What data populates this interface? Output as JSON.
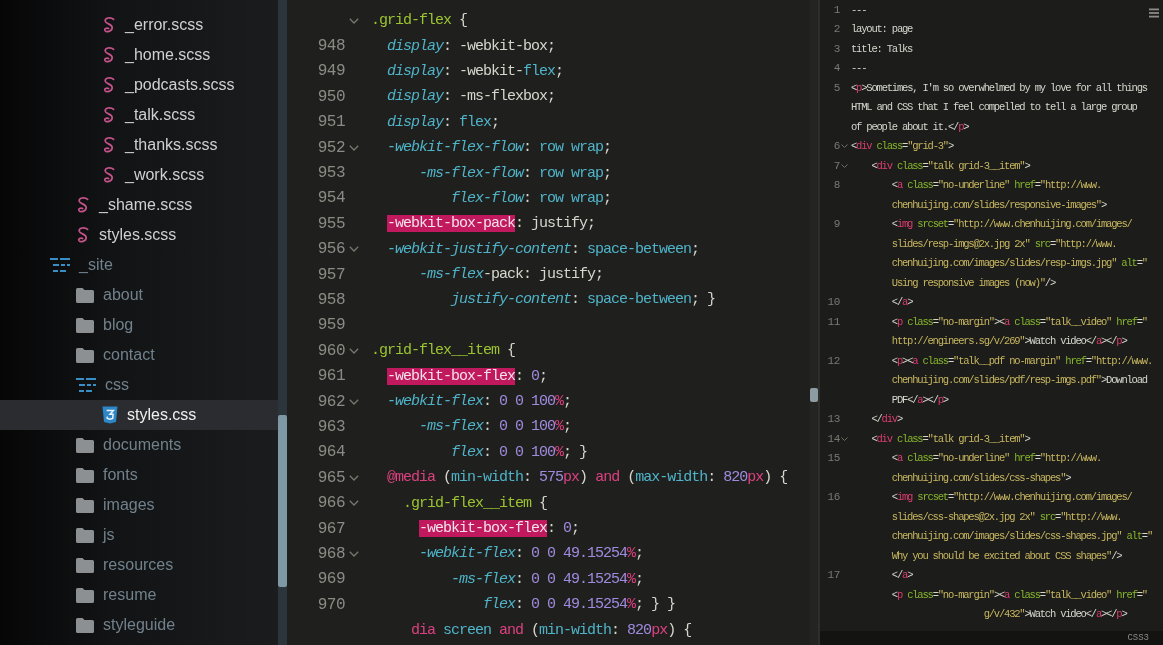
{
  "file_tree": {
    "items": [
      {
        "children": [
          {
            "children": [
              {
                "label": "_error.scss",
                "kind": "scss",
                "selected": false
              },
              {
                "label": "_home.scss",
                "kind": "scss",
                "selected": false
              },
              {
                "label": "_podcasts.scss",
                "kind": "scss",
                "selected": false
              },
              {
                "label": "_talk.scss",
                "kind": "scss",
                "selected": false
              },
              {
                "label": "_thanks.scss",
                "kind": "scss",
                "selected": false
              },
              {
                "label": "_work.scss",
                "kind": "scss",
                "selected": false
              }
            ]
          },
          {
            "label": "_shame.scss",
            "kind": "scss",
            "selected": false
          },
          {
            "label": "styles.scss",
            "kind": "scss",
            "selected": false
          }
        ]
      },
      {
        "label": "_site",
        "kind": "folder",
        "expanded": true,
        "selected": false,
        "children": [
          {
            "label": "about",
            "kind": "folder",
            "expanded": false,
            "selected": false
          },
          {
            "label": "blog",
            "kind": "folder",
            "expanded": false,
            "selected": false
          },
          {
            "label": "contact",
            "kind": "folder",
            "expanded": false,
            "selected": false
          },
          {
            "label": "css",
            "kind": "folder",
            "expanded": true,
            "selected": false,
            "children": [
              {
                "label": "styles.css",
                "kind": "css",
                "selected": true
              }
            ]
          },
          {
            "label": "documents",
            "kind": "folder",
            "expanded": false,
            "selected": false
          },
          {
            "label": "fonts",
            "kind": "folder",
            "expanded": false,
            "selected": false
          },
          {
            "label": "images",
            "kind": "folder",
            "expanded": false,
            "selected": false
          },
          {
            "label": "js",
            "kind": "folder",
            "expanded": false,
            "selected": false
          },
          {
            "label": "resources",
            "kind": "folder",
            "expanded": false,
            "selected": false
          },
          {
            "label": "resume",
            "kind": "folder",
            "expanded": false,
            "selected": false
          },
          {
            "label": "styleguide",
            "kind": "folder",
            "expanded": false,
            "selected": false
          }
        ]
      }
    ]
  },
  "main_editor": {
    "lines": [
      {
        "foldable": true,
        "rows": [
          {
            "tokens": [
              {
                "kind": "selector",
                "text": ".grid-flex"
              },
              {
                "kind": "punct",
                "text": " {"
              }
            ]
          }
        ]
      },
      {
        "number": "948",
        "foldable": false,
        "rows": [
          {
            "tokens": [
              {
                "kind": "property",
                "text": "  display"
              },
              {
                "kind": "punct",
                "text": ": "
              },
              {
                "kind": "plain",
                "text": "-webkit-box"
              },
              {
                "kind": "punct",
                "text": ";"
              }
            ]
          }
        ]
      },
      {
        "number": "949",
        "foldable": false,
        "rows": [
          {
            "tokens": [
              {
                "kind": "property",
                "text": "  display"
              },
              {
                "kind": "punct",
                "text": ": "
              },
              {
                "kind": "plain",
                "text": "-webkit-"
              },
              {
                "kind": "value",
                "text": "flex"
              },
              {
                "kind": "punct",
                "text": ";"
              }
            ]
          }
        ]
      },
      {
        "number": "950",
        "foldable": false,
        "rows": [
          {
            "tokens": [
              {
                "kind": "property",
                "text": "  display"
              },
              {
                "kind": "punct",
                "text": ": "
              },
              {
                "kind": "plain",
                "text": "-ms-flexbox"
              },
              {
                "kind": "punct",
                "text": ";"
              }
            ]
          }
        ]
      },
      {
        "number": "951",
        "foldable": false,
        "rows": [
          {
            "tokens": [
              {
                "kind": "property",
                "text": "  display"
              },
              {
                "kind": "punct",
                "text": ": "
              },
              {
                "kind": "value",
                "text": "flex"
              },
              {
                "kind": "punct",
                "text": ";"
              }
            ]
          }
        ]
      },
      {
        "number": "952",
        "foldable": true,
        "rows": [
          {
            "tokens": [
              {
                "kind": "property",
                "text": "  -webkit-flex-flow"
              },
              {
                "kind": "punct",
                "text": ": "
              },
              {
                "kind": "value",
                "text": "row wrap"
              },
              {
                "kind": "punct",
                "text": ";"
              }
            ]
          }
        ]
      },
      {
        "number": "953",
        "foldable": false,
        "rows": [
          {
            "tokens": [
              {
                "kind": "property",
                "text": "      -ms-flex-flow"
              },
              {
                "kind": "punct",
                "text": ": "
              },
              {
                "kind": "value",
                "text": "row wrap"
              },
              {
                "kind": "punct",
                "text": ";"
              }
            ]
          }
        ]
      },
      {
        "number": "954",
        "foldable": false,
        "rows": [
          {
            "tokens": [
              {
                "kind": "property",
                "text": "          flex-flow"
              },
              {
                "kind": "punct",
                "text": ": "
              },
              {
                "kind": "value",
                "text": "row wrap"
              },
              {
                "kind": "punct",
                "text": ";"
              }
            ]
          }
        ]
      },
      {
        "number": "955",
        "foldable": false,
        "rows": [
          {
            "tokens": [
              {
                "kind": "match",
                "text": "  -webkit-box-pack"
              },
              {
                "kind": "punct",
                "text": ": "
              },
              {
                "kind": "plain",
                "text": "justify"
              },
              {
                "kind": "punct",
                "text": ";"
              }
            ]
          }
        ]
      },
      {
        "number": "956",
        "foldable": true,
        "rows": [
          {
            "tokens": [
              {
                "kind": "property",
                "text": "  -webkit-justify-content"
              },
              {
                "kind": "punct",
                "text": ": "
              },
              {
                "kind": "value",
                "text": "space-between"
              },
              {
                "kind": "punct",
                "text": ";"
              }
            ]
          }
        ]
      },
      {
        "number": "957",
        "foldable": false,
        "rows": [
          {
            "tokens": [
              {
                "kind": "property",
                "text": "      -ms-flex"
              },
              {
                "kind": "plain",
                "text": "-pack"
              },
              {
                "kind": "punct",
                "text": ": "
              },
              {
                "kind": "plain",
                "text": "justify"
              },
              {
                "kind": "punct",
                "text": ";"
              }
            ]
          }
        ]
      },
      {
        "number": "958",
        "foldable": false,
        "rows": [
          {
            "tokens": [
              {
                "kind": "property",
                "text": "          justify-content"
              },
              {
                "kind": "punct",
                "text": ": "
              },
              {
                "kind": "value",
                "text": "space-between"
              },
              {
                "kind": "punct",
                "text": "; }"
              }
            ]
          }
        ]
      },
      {
        "number": "959",
        "foldable": false
      },
      {
        "number": "960",
        "foldable": true,
        "rows": [
          {
            "tokens": [
              {
                "kind": "selector",
                "text": ".grid-flex__item"
              },
              {
                "kind": "punct",
                "text": " {"
              }
            ]
          }
        ]
      },
      {
        "number": "961",
        "foldable": false,
        "rows": [
          {
            "tokens": [
              {
                "kind": "match",
                "text": "  -webkit-box-flex"
              },
              {
                "kind": "punct",
                "text": ": "
              },
              {
                "kind": "number",
                "text": "0"
              },
              {
                "kind": "punct",
                "text": ";"
              }
            ]
          }
        ]
      },
      {
        "number": "962",
        "foldable": true,
        "rows": [
          {
            "tokens": [
              {
                "kind": "property",
                "text": "  -webkit-flex"
              },
              {
                "kind": "punct",
                "text": ": "
              },
              {
                "kind": "number",
                "text": "0 0 100"
              },
              {
                "kind": "unit",
                "text": "%"
              },
              {
                "kind": "punct",
                "text": ";"
              }
            ]
          }
        ]
      },
      {
        "number": "963",
        "foldable": false,
        "rows": [
          {
            "tokens": [
              {
                "kind": "property",
                "text": "      -ms-flex"
              },
              {
                "kind": "punct",
                "text": ": "
              },
              {
                "kind": "number",
                "text": "0 0 100"
              },
              {
                "kind": "unit",
                "text": "%"
              },
              {
                "kind": "punct",
                "text": ";"
              }
            ]
          }
        ]
      },
      {
        "number": "964",
        "foldable": false,
        "rows": [
          {
            "tokens": [
              {
                "kind": "property",
                "text": "          flex"
              },
              {
                "kind": "punct",
                "text": ": "
              },
              {
                "kind": "number",
                "text": "0 0 100"
              },
              {
                "kind": "unit",
                "text": "%"
              },
              {
                "kind": "punct",
                "text": "; }"
              }
            ]
          }
        ]
      },
      {
        "number": "965",
        "foldable": true,
        "rows": [
          {
            "tokens": [
              {
                "kind": "atrule",
                "text": "  @media"
              },
              {
                "kind": "punct",
                "text": " ("
              },
              {
                "kind": "value",
                "text": "min-width"
              },
              {
                "kind": "punct",
                "text": ": "
              },
              {
                "kind": "number",
                "text": "575"
              },
              {
                "kind": "unit",
                "text": "px"
              },
              {
                "kind": "punct",
                "text": ") "
              },
              {
                "kind": "atrule",
                "text": "and"
              },
              {
                "kind": "punct",
                "text": " ("
              },
              {
                "kind": "value",
                "text": "max-width"
              },
              {
                "kind": "punct",
                "text": ": "
              },
              {
                "kind": "number",
                "text": "820"
              },
              {
                "kind": "unit",
                "text": "px"
              },
              {
                "kind": "punct",
                "text": ") {"
              }
            ]
          }
        ]
      },
      {
        "number": "966",
        "foldable": true,
        "rows": [
          {
            "tokens": [
              {
                "kind": "selector",
                "text": "    .grid-flex__item"
              },
              {
                "kind": "punct",
                "text": " {"
              }
            ]
          }
        ]
      },
      {
        "number": "967",
        "foldable": false,
        "rows": [
          {
            "tokens": [
              {
                "kind": "match",
                "text": "      -webkit-box-flex"
              },
              {
                "kind": "punct",
                "text": ": "
              },
              {
                "kind": "number",
                "text": "0"
              },
              {
                "kind": "punct",
                "text": ";"
              }
            ]
          }
        ]
      },
      {
        "number": "968",
        "foldable": true,
        "rows": [
          {
            "tokens": [
              {
                "kind": "property",
                "text": "      -webkit-flex"
              },
              {
                "kind": "punct",
                "text": ": "
              },
              {
                "kind": "number",
                "text": "0 0 49.15254"
              },
              {
                "kind": "unit",
                "text": "%"
              },
              {
                "kind": "punct",
                "text": ";"
              }
            ]
          }
        ]
      },
      {
        "number": "969",
        "foldable": false,
        "rows": [
          {
            "tokens": [
              {
                "kind": "property",
                "text": "          -ms-flex"
              },
              {
                "kind": "punct",
                "text": ": "
              },
              {
                "kind": "number",
                "text": "0 0 49.15254"
              },
              {
                "kind": "unit",
                "text": "%"
              },
              {
                "kind": "punct",
                "text": ";"
              }
            ]
          }
        ]
      },
      {
        "number": "970",
        "foldable": false,
        "rows": [
          {
            "tokens": [
              {
                "kind": "property",
                "text": "              flex"
              },
              {
                "kind": "punct",
                "text": ": "
              },
              {
                "kind": "number",
                "text": "0 0 49.15254"
              },
              {
                "kind": "unit",
                "text": "%"
              },
              {
                "kind": "punct",
                "text": "; } }"
              }
            ]
          }
        ]
      },
      {
        "foldable": false,
        "rows": [
          {
            "tokens": [
              {
                "kind": "atrule",
                "text": "     dia"
              },
              {
                "kind": "value",
                "text": " screen "
              },
              {
                "kind": "atrule",
                "text": "and"
              },
              {
                "kind": "punct",
                "text": " ("
              },
              {
                "kind": "value",
                "text": "min-width"
              },
              {
                "kind": "punct",
                "text": ": "
              },
              {
                "kind": "number",
                "text": "820"
              },
              {
                "kind": "unit",
                "text": "px"
              },
              {
                "kind": "punct",
                "text": ") {"
              }
            ]
          }
        ]
      }
    ]
  },
  "side_editor": {
    "lines": [
      {
        "number": "1",
        "foldable": false,
        "rows": [
          {
            "tokens": [
              {
                "kind": "text",
                "text": "---"
              }
            ]
          }
        ]
      },
      {
        "number": "2",
        "foldable": false,
        "rows": [
          {
            "tokens": [
              {
                "kind": "text",
                "text": "layout: page"
              }
            ]
          }
        ]
      },
      {
        "number": "3",
        "foldable": false,
        "rows": [
          {
            "tokens": [
              {
                "kind": "text",
                "text": "title: Talks"
              }
            ]
          }
        ]
      },
      {
        "number": "4",
        "foldable": false,
        "rows": [
          {
            "tokens": [
              {
                "kind": "text",
                "text": "---"
              }
            ]
          }
        ]
      },
      {
        "number": "5",
        "foldable": false,
        "rows": [
          {
            "tokens": [
              {
                "kind": "punct",
                "text": "<"
              },
              {
                "kind": "tag",
                "text": "p"
              },
              {
                "kind": "punct",
                "text": ">"
              },
              {
                "kind": "text",
                "text": "Sometimes, I'm so overwhelmed by my love for all things"
              }
            ]
          },
          {
            "tokens": [
              {
                "kind": "text",
                "text": "HTML and CSS that I feel compelled to tell a large group"
              }
            ]
          },
          {
            "tokens": [
              {
                "kind": "text",
                "text": "of people about it."
              },
              {
                "kind": "punct",
                "text": "</"
              },
              {
                "kind": "tag",
                "text": "p"
              },
              {
                "kind": "punct",
                "text": ">"
              }
            ]
          }
        ]
      },
      {
        "number": "6",
        "foldable": true,
        "rows": [
          {
            "tokens": [
              {
                "kind": "punct",
                "text": "<"
              },
              {
                "kind": "tag",
                "text": "div"
              },
              {
                "kind": "attr",
                "text": " class"
              },
              {
                "kind": "punct",
                "text": "="
              },
              {
                "kind": "string",
                "text": "\"grid-3\""
              },
              {
                "kind": "punct",
                "text": ">"
              }
            ]
          }
        ]
      },
      {
        "number": "7",
        "foldable": true,
        "rows": [
          {
            "tokens": [
              {
                "kind": "punct",
                "text": "    <"
              },
              {
                "kind": "tag",
                "text": "div"
              },
              {
                "kind": "attr",
                "text": " class"
              },
              {
                "kind": "punct",
                "text": "="
              },
              {
                "kind": "string",
                "text": "\"talk grid-3__item\""
              },
              {
                "kind": "punct",
                "text": ">"
              }
            ]
          }
        ]
      },
      {
        "number": "8",
        "foldable": false,
        "rows": [
          {
            "tokens": [
              {
                "kind": "punct",
                "text": "        <"
              },
              {
                "kind": "tag",
                "text": "a"
              },
              {
                "kind": "attr",
                "text": " class"
              },
              {
                "kind": "punct",
                "text": "="
              },
              {
                "kind": "string",
                "text": "\"no-underline\""
              },
              {
                "kind": "attr",
                "text": " href"
              },
              {
                "kind": "punct",
                "text": "="
              },
              {
                "kind": "string",
                "text": "\"http://www."
              }
            ]
          },
          {
            "tokens": [
              {
                "kind": "string",
                "text": "        chenhuijing.com/slides/responsive-images\""
              },
              {
                "kind": "punct",
                "text": ">"
              }
            ]
          }
        ]
      },
      {
        "number": "9",
        "foldable": false,
        "rows": [
          {
            "tokens": [
              {
                "kind": "punct",
                "text": "        <"
              },
              {
                "kind": "tag",
                "text": "img"
              },
              {
                "kind": "attr",
                "text": " srcset"
              },
              {
                "kind": "punct",
                "text": "="
              },
              {
                "kind": "string",
                "text": "\"http://www.chenhuijing.com/images/"
              }
            ]
          },
          {
            "tokens": [
              {
                "kind": "string",
                "text": "        slides/resp-imgs@2x.jpg 2x\""
              },
              {
                "kind": "attr",
                "text": " src"
              },
              {
                "kind": "punct",
                "text": "="
              },
              {
                "kind": "string",
                "text": "\"http://www."
              }
            ]
          },
          {
            "tokens": [
              {
                "kind": "string",
                "text": "        chenhuijing.com/images/slides/resp-imgs.jpg\""
              },
              {
                "kind": "attr",
                "text": " alt"
              },
              {
                "kind": "punct",
                "text": "="
              },
              {
                "kind": "string",
                "text": "\""
              }
            ]
          },
          {
            "tokens": [
              {
                "kind": "string",
                "text": "        Using responsive images (now)\""
              },
              {
                "kind": "punct",
                "text": "/>"
              }
            ]
          }
        ]
      },
      {
        "number": "10",
        "foldable": false,
        "rows": [
          {
            "tokens": [
              {
                "kind": "punct",
                "text": "        </"
              },
              {
                "kind": "tag",
                "text": "a"
              },
              {
                "kind": "punct",
                "text": ">"
              }
            ]
          }
        ]
      },
      {
        "number": "11",
        "foldable": false,
        "rows": [
          {
            "tokens": [
              {
                "kind": "punct",
                "text": "        <"
              },
              {
                "kind": "tag",
                "text": "p"
              },
              {
                "kind": "attr",
                "text": " class"
              },
              {
                "kind": "punct",
                "text": "="
              },
              {
                "kind": "string",
                "text": "\"no-margin\""
              },
              {
                "kind": "punct",
                "text": "><"
              },
              {
                "kind": "tag",
                "text": "a"
              },
              {
                "kind": "attr",
                "text": " class"
              },
              {
                "kind": "punct",
                "text": "="
              },
              {
                "kind": "string",
                "text": "\"talk__video\""
              },
              {
                "kind": "attr",
                "text": " href"
              },
              {
                "kind": "punct",
                "text": "="
              },
              {
                "kind": "string",
                "text": "\""
              }
            ]
          },
          {
            "tokens": [
              {
                "kind": "string",
                "text": "        http://engineers.sg/v/269\""
              },
              {
                "kind": "punct",
                "text": ">"
              },
              {
                "kind": "text",
                "text": "Watch video"
              },
              {
                "kind": "punct",
                "text": "</"
              },
              {
                "kind": "tag",
                "text": "a"
              },
              {
                "kind": "punct",
                "text": "></"
              },
              {
                "kind": "tag",
                "text": "p"
              },
              {
                "kind": "punct",
                "text": ">"
              }
            ]
          }
        ]
      },
      {
        "number": "12",
        "foldable": false,
        "rows": [
          {
            "tokens": [
              {
                "kind": "punct",
                "text": "        <"
              },
              {
                "kind": "tag",
                "text": "p"
              },
              {
                "kind": "punct",
                "text": "><"
              },
              {
                "kind": "tag",
                "text": "a"
              },
              {
                "kind": "attr",
                "text": " class"
              },
              {
                "kind": "punct",
                "text": "="
              },
              {
                "kind": "string",
                "text": "\"talk__pdf no-margin\""
              },
              {
                "kind": "attr",
                "text": " href"
              },
              {
                "kind": "punct",
                "text": "="
              },
              {
                "kind": "string",
                "text": "\"http://www."
              }
            ]
          },
          {
            "tokens": [
              {
                "kind": "string",
                "text": "        chenhuijing.com/slides/pdf/resp-imgs.pdf\""
              },
              {
                "kind": "punct",
                "text": ">"
              },
              {
                "kind": "text",
                "text": "Download"
              }
            ]
          },
          {
            "tokens": [
              {
                "kind": "text",
                "text": "        PDF"
              },
              {
                "kind": "punct",
                "text": "</"
              },
              {
                "kind": "tag",
                "text": "a"
              },
              {
                "kind": "punct",
                "text": "></"
              },
              {
                "kind": "tag",
                "text": "p"
              },
              {
                "kind": "punct",
                "text": ">"
              }
            ]
          }
        ]
      },
      {
        "number": "13",
        "foldable": false,
        "rows": [
          {
            "tokens": [
              {
                "kind": "punct",
                "text": "    </"
              },
              {
                "kind": "tag",
                "text": "div"
              },
              {
                "kind": "punct",
                "text": ">"
              }
            ]
          }
        ]
      },
      {
        "number": "14",
        "foldable": true,
        "rows": [
          {
            "tokens": [
              {
                "kind": "punct",
                "text": "    <"
              },
              {
                "kind": "tag",
                "text": "div"
              },
              {
                "kind": "attr",
                "text": " class"
              },
              {
                "kind": "punct",
                "text": "="
              },
              {
                "kind": "string",
                "text": "\"talk grid-3__item\""
              },
              {
                "kind": "punct",
                "text": ">"
              }
            ]
          }
        ]
      },
      {
        "number": "15",
        "foldable": false,
        "rows": [
          {
            "tokens": [
              {
                "kind": "punct",
                "text": "        <"
              },
              {
                "kind": "tag",
                "text": "a"
              },
              {
                "kind": "attr",
                "text": " class"
              },
              {
                "kind": "punct",
                "text": "="
              },
              {
                "kind": "string",
                "text": "\"no-underline\""
              },
              {
                "kind": "attr",
                "text": " href"
              },
              {
                "kind": "punct",
                "text": "="
              },
              {
                "kind": "string",
                "text": "\"http://www."
              }
            ]
          },
          {
            "tokens": [
              {
                "kind": "string",
                "text": "        chenhuijing.com/slides/css-shapes\""
              },
              {
                "kind": "punct",
                "text": ">"
              }
            ]
          }
        ]
      },
      {
        "number": "16",
        "foldable": false,
        "rows": [
          {
            "tokens": [
              {
                "kind": "punct",
                "text": "        <"
              },
              {
                "kind": "tag",
                "text": "img"
              },
              {
                "kind": "attr",
                "text": " srcset"
              },
              {
                "kind": "punct",
                "text": "="
              },
              {
                "kind": "string",
                "text": "\"http://www.chenhuijing.com/images/"
              }
            ]
          },
          {
            "tokens": [
              {
                "kind": "string",
                "text": "        slides/css-shapes@2x.jpg 2x\""
              },
              {
                "kind": "attr",
                "text": " src"
              },
              {
                "kind": "punct",
                "text": "="
              },
              {
                "kind": "string",
                "text": "\"http://www."
              }
            ]
          },
          {
            "tokens": [
              {
                "kind": "string",
                "text": "        chenhuijing.com/images/slides/css-shapes.jpg\""
              },
              {
                "kind": "attr",
                "text": " alt"
              },
              {
                "kind": "punct",
                "text": "="
              },
              {
                "kind": "string",
                "text": "\""
              }
            ]
          },
          {
            "tokens": [
              {
                "kind": "string",
                "text": "        Why you should be excited about CSS shapes\""
              },
              {
                "kind": "punct",
                "text": "/>"
              }
            ]
          }
        ]
      },
      {
        "number": "17",
        "foldable": false,
        "rows": [
          {
            "tokens": [
              {
                "kind": "punct",
                "text": "        </"
              },
              {
                "kind": "tag",
                "text": "a"
              },
              {
                "kind": "punct",
                "text": ">"
              }
            ]
          }
        ]
      },
      {
        "foldable": false,
        "rows": [
          {
            "tokens": [
              {
                "kind": "punct",
                "text": "        <"
              },
              {
                "kind": "tag",
                "text": "p"
              },
              {
                "kind": "attr",
                "text": " class"
              },
              {
                "kind": "punct",
                "text": "="
              },
              {
                "kind": "string",
                "text": "\"no-margin\""
              },
              {
                "kind": "punct",
                "text": "><"
              },
              {
                "kind": "tag",
                "text": "a"
              },
              {
                "kind": "attr",
                "text": " class"
              },
              {
                "kind": "punct",
                "text": "="
              },
              {
                "kind": "string",
                "text": "\"talk__video\""
              },
              {
                "kind": "attr",
                "text": " href"
              },
              {
                "kind": "punct",
                "text": "="
              },
              {
                "kind": "string",
                "text": "\""
              }
            ]
          },
          {
            "tokens": [
              {
                "kind": "string",
                "text": "                          g/v/432\""
              },
              {
                "kind": "punct",
                "text": ">"
              },
              {
                "kind": "text",
                "text": "Watch video"
              },
              {
                "kind": "punct",
                "text": "</"
              },
              {
                "kind": "tag",
                "text": "a"
              },
              {
                "kind": "punct",
                "text": "></"
              },
              {
                "kind": "tag",
                "text": "p"
              },
              {
                "kind": "punct",
                "text": ">"
              }
            ]
          }
        ]
      }
    ],
    "status_bar": {
      "syntax": "CSS3"
    }
  }
}
